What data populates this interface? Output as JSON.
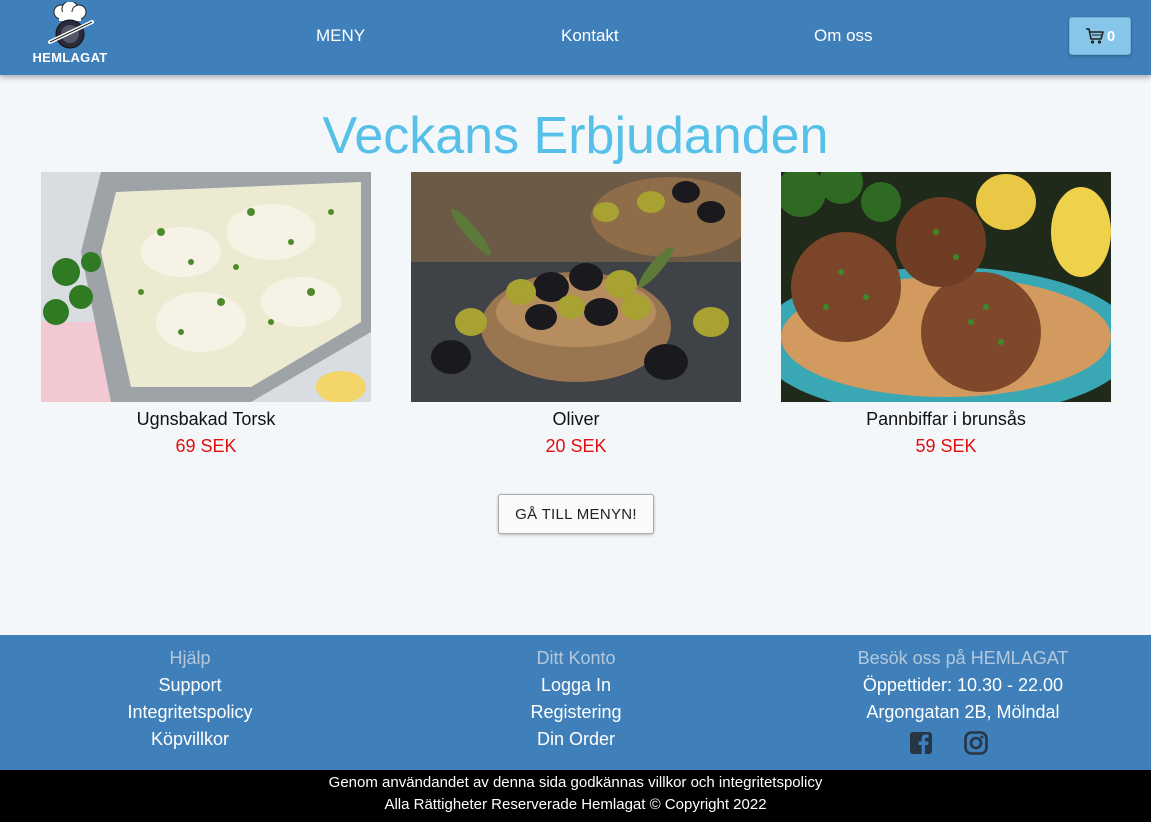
{
  "header": {
    "logo_text": "HEMLAGAT",
    "nav": [
      "MENY",
      "Kontakt",
      "Om oss"
    ],
    "cart_count": "0"
  },
  "main": {
    "title": "Veckans Erbjudanden",
    "products": [
      {
        "name": "Ugnsbakad Torsk",
        "price": "69 SEK",
        "image": "baked-cod-photo"
      },
      {
        "name": "Oliver",
        "price": "20 SEK",
        "image": "olives-photo"
      },
      {
        "name": "Pannbiffar i brunsås",
        "price": "59 SEK",
        "image": "meat-patties-photo"
      }
    ],
    "menu_button": "GÅ TILL MENYN!"
  },
  "footer": {
    "help": {
      "heading": "Hjälp",
      "links": [
        "Support",
        "Integritetspolicy",
        "Köpvillkor"
      ]
    },
    "account": {
      "heading": "Ditt Konto",
      "links": [
        "Logga In",
        "Registering",
        "Din Order"
      ]
    },
    "visit": {
      "heading": "Besök oss på HEMLAGAT",
      "hours": "Öppettider: 10.30 - 22.00",
      "address": "Argongatan 2B, Mölndal"
    },
    "social_icons": [
      "facebook-icon",
      "instagram-icon"
    ],
    "bottom_line1": "Genom användandet av denna sida godkännas villkor och integritetspolicy",
    "bottom_line2": "Alla Rättigheter Reserverade Hemlagat © Copyright 2022"
  },
  "colors": {
    "header_bg": "#3f80ba",
    "title": "#56c0e8",
    "price": "#e01010",
    "cart_button": "#87c6e8"
  }
}
